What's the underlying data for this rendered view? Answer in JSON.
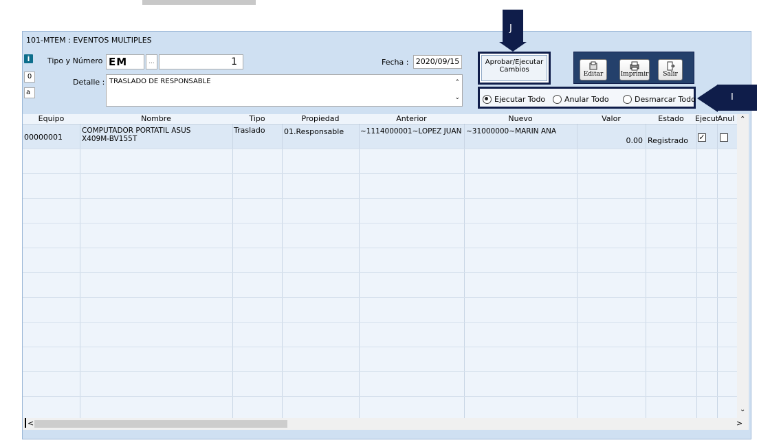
{
  "window": {
    "title": "101-MTEM : EVENTOS MULTIPLES"
  },
  "side_controls": {
    "info_icon": "i",
    "box_top": "0",
    "box_bottom": "a"
  },
  "form": {
    "tipo_label": "Tipo y Número :",
    "tipo_value": "EM",
    "lookup_label": "...",
    "numero_value": "1",
    "fecha_label": "Fecha :",
    "fecha_value": "2020/09/15",
    "detalle_label": "Detalle :",
    "detalle_value": "TRASLADO DE RESPONSABLE"
  },
  "approve_button": {
    "label": "Aprobar/Ejecutar Cambios"
  },
  "toolbar": {
    "edit_label": "Editar",
    "print_label": "Imprimir",
    "exit_label": "Salir"
  },
  "radios": {
    "options": [
      "Ejecutar Todo",
      "Anular Todo",
      "Desmarcar Todo"
    ],
    "selected": "Ejecutar Todo"
  },
  "callouts": {
    "j": "J",
    "i": "I"
  },
  "table": {
    "columns": [
      "Equipo",
      "Nombre",
      "Tipo",
      "Propiedad",
      "Anterior",
      "Nuevo",
      "Valor",
      "Estado",
      "Ejecut",
      "Anul"
    ],
    "rows": [
      {
        "equipo": "00000001",
        "nombre": "COMPUTADOR PORTATIL ASUS X409M-BV155T",
        "tipo": "Traslado",
        "propiedad": "01.Responsable",
        "anterior": "~1114000001~LOPEZ JUAN",
        "nuevo": "~31000000~MARIN ANA",
        "valor": "0.00",
        "estado": "Registrado",
        "ejecut": true,
        "anul": false
      }
    ]
  },
  "colors": {
    "window_bg": "#cfe0f2",
    "callout": "#0f1d4a",
    "grid_bg": "#eef4fb",
    "selected_row": "#dce8f5"
  }
}
